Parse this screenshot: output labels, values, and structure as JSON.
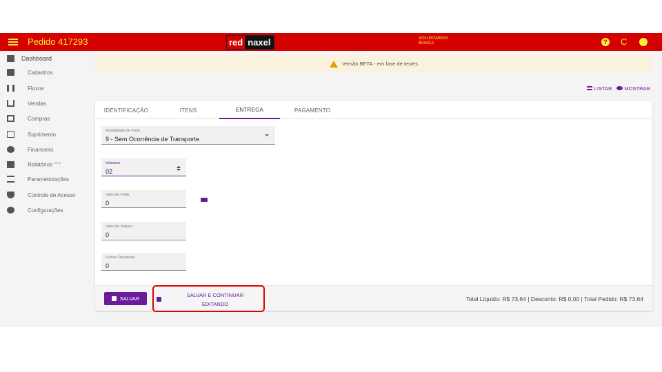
{
  "topbar": {
    "title": "Pedido 417293",
    "logo_left": "red",
    "logo_right": "naxel",
    "user_line1": "VOLUNTARIOS",
    "user_line2": "BIANCA",
    "help_icon": "?",
    "reload_icon": "C"
  },
  "sidebar": {
    "items": [
      {
        "label": "Dashboard",
        "icon": "dashboard-icon"
      },
      {
        "label": "Cadastros",
        "icon": "folder-icon"
      },
      {
        "label": "Fluxos",
        "icon": "columns-icon"
      },
      {
        "label": "Vendas",
        "icon": "cart-icon"
      },
      {
        "label": "Compras",
        "icon": "store-icon"
      },
      {
        "label": "Suprimento",
        "icon": "supply-icon"
      },
      {
        "label": "Financeiro",
        "icon": "dollar-icon"
      },
      {
        "label": "Relatórios",
        "badge": "BETA",
        "icon": "printer-icon"
      },
      {
        "label": "Parametrizações",
        "icon": "sliders-icon"
      },
      {
        "label": "Controle de Acesso",
        "icon": "shield-icon"
      },
      {
        "label": "Configurações",
        "icon": "gear-icon"
      }
    ]
  },
  "banner": {
    "text": "Versão BETA - em fase de testes"
  },
  "actions": {
    "list_label": "LISTAR",
    "show_label": "MOSTRAR"
  },
  "tabs": [
    {
      "label": "IDENTIFICAÇÃO"
    },
    {
      "label": "ITENS"
    },
    {
      "label": "ENTREGA",
      "active": true
    },
    {
      "label": "PAGAMENTO"
    }
  ],
  "form": {
    "modalidade": {
      "label": "Modalidade de Frete",
      "value": "9 - Sem Ocorrência de Transporte"
    },
    "volumes": {
      "label": "Volumes",
      "value": "02"
    },
    "valor_frete": {
      "label": "Valor do Frete",
      "value": "0"
    },
    "valor_seguro": {
      "label": "Valor do Seguro",
      "value": "0"
    },
    "outras_despesas": {
      "label": "Outras Despesas",
      "value": "0"
    }
  },
  "footer": {
    "save_label": "SALVAR",
    "save_continue_line1": "SALVAR E CONTINUAR",
    "save_continue_line2": "EDITANDO",
    "totals": "Total Líquido: R$ 73,64 | Desconto: R$ 0,00 | Total Pedido: R$ 73,64"
  },
  "colors": {
    "topbar": "#d50000",
    "accent": "#6a1b9a",
    "title_text": "#ffeb3b",
    "banner": "#fbf2dd"
  }
}
